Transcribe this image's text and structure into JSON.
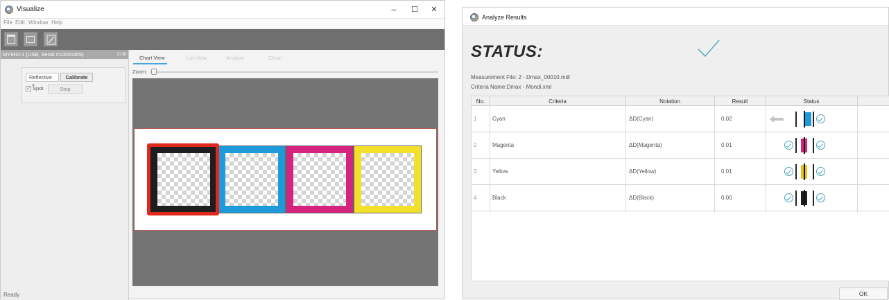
{
  "visualize": {
    "window_title": "Visualize",
    "window_controls": {
      "minimize": "–",
      "maximize": "☐",
      "close": "✕"
    },
    "menu": [
      "File",
      "Edit",
      "Window",
      "Help"
    ],
    "toolbar_icons": [
      "new-document-icon",
      "gallery-icon",
      "export-icon"
    ],
    "device_label": "MYIRO-1 (USB, Serial #10000305)",
    "device_dock": "⊡ ⊠",
    "mode_select": "Reflective",
    "calibrate_label": "Calibrate",
    "spot_checked": true,
    "spot_check_glyph": "✓",
    "spot_label": "Spot",
    "stop_label": "Stop",
    "tabs": [
      "Chart View",
      "List View",
      "Analyze",
      "Clean"
    ],
    "active_tab": "Chart View",
    "zoom_label": "Zoom:",
    "patches": [
      {
        "name": "black",
        "color": "#1e1e1e",
        "selected": true
      },
      {
        "name": "cyan",
        "color": "#1f9ad8"
      },
      {
        "name": "magenta",
        "color": "#d6237f"
      },
      {
        "name": "yellow",
        "color": "#f2e02b"
      }
    ],
    "status": "Ready"
  },
  "analyze": {
    "window_title": "Analyze Results",
    "status_heading": "STATUS:",
    "status_icon": "checkmark-icon",
    "measurement_file": "Measurement File: 2 - Dmax_00010.mdl",
    "criteria_name": "Criteria Name:Dmax - Mondi.xml",
    "columns": [
      "No.",
      "Criteria",
      "Notation",
      "Result",
      "Status"
    ],
    "rows": [
      {
        "no": "1",
        "criteria": "Cyan",
        "notation": "ΔD(Cyan)",
        "result": "0.02",
        "color": "#1f9ad8",
        "left_indicator": "arrow"
      },
      {
        "no": "2",
        "criteria": "Magenta",
        "notation": "ΔD(Magenta)",
        "result": "0.01",
        "color": "#d6237f",
        "left_indicator": "ok"
      },
      {
        "no": "3",
        "criteria": "Yellow",
        "notation": "ΔD(Yellow)",
        "result": "0.01",
        "color": "#e8c21e",
        "left_indicator": "ok"
      },
      {
        "no": "4",
        "criteria": "Black",
        "notation": "ΔD(Black)",
        "result": "0.00",
        "color": "#1e1e1e",
        "left_indicator": "ok"
      }
    ],
    "ok_label": "OK"
  }
}
